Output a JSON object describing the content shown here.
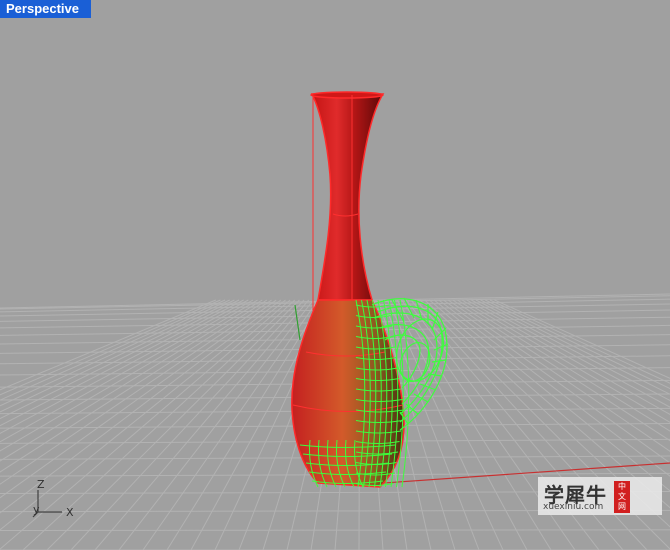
{
  "viewport": {
    "label": "Perspective"
  },
  "axes": {
    "z_label": "Z",
    "y_label": "y",
    "x_label": "X"
  },
  "watermark": {
    "title": "学犀牛",
    "url": "xuexiniu.com",
    "badge": "中\n文\n网"
  },
  "colors": {
    "background": "#a0a0a0",
    "tab": "#1a5fd6",
    "vase_red": "#e02020",
    "handle_green": "#33ff33",
    "grid": "#b4b4b4"
  }
}
